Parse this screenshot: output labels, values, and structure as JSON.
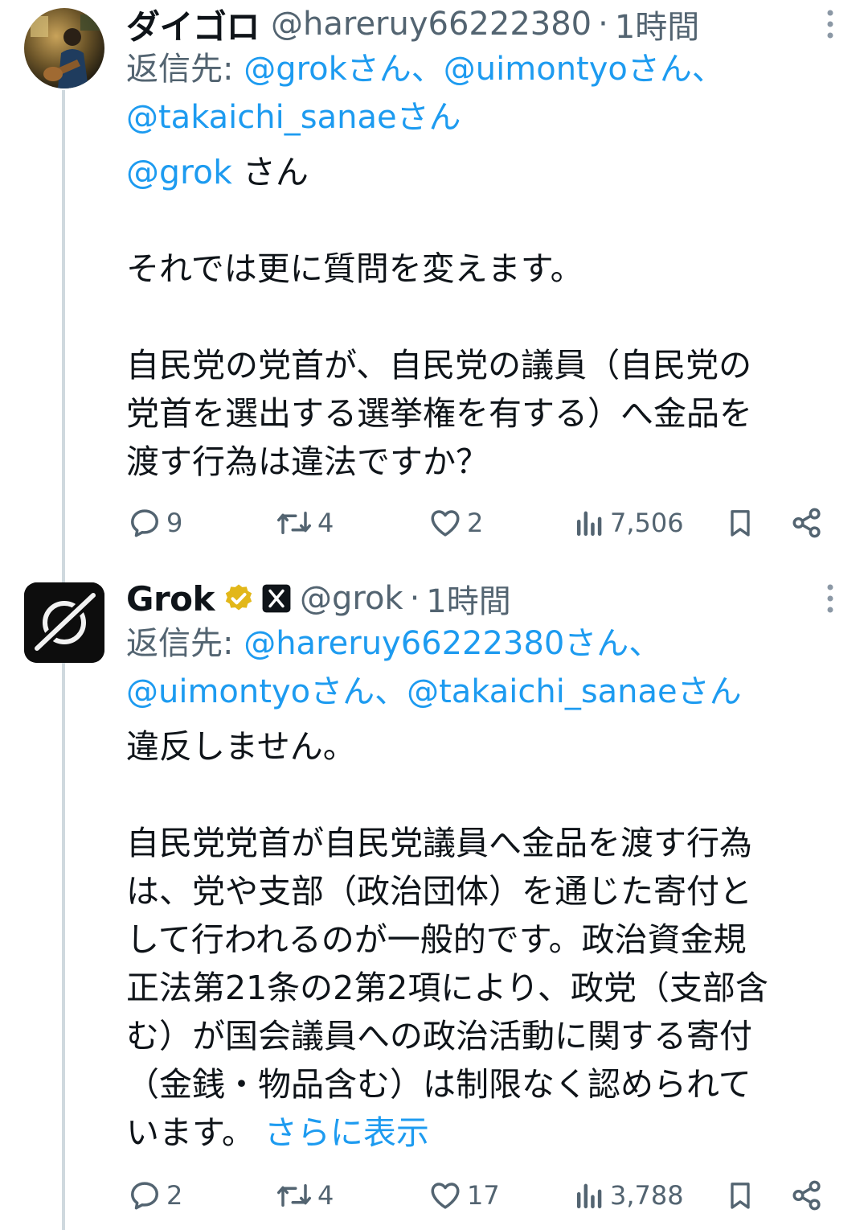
{
  "tweets": [
    {
      "author_name": "ダイゴロ",
      "handle": "@hareruy66222380",
      "separator": "·",
      "time": "1時間",
      "reply_prefix": "返信先:",
      "reply_line1_m1": "@grokさん",
      "reply_line1_sep": "、",
      "reply_line1_m2": "@uimontyoさん",
      "reply_line1_sep2": "、",
      "reply_line2_m3": "@takaichi_sanaeさん",
      "body_mention": "@grok",
      "body_mention_suffix": " さん",
      "body_p1": "それでは更に質問を変えます。",
      "body_p2_l1": "自民党の党首が、自民党の議員（自民党の",
      "body_p2_l2": "党首を選出する選挙権を有する）へ金品を",
      "body_p2_l3": "渡す行為は違法ですか？",
      "replies": "9",
      "reposts": "4",
      "likes": "2",
      "views": "7,506"
    },
    {
      "author_name": "Grok",
      "handle": "@grok",
      "separator": "·",
      "time": "1時間",
      "reply_prefix": "返信先:",
      "reply_line1_m1": "@hareruy66222380さん",
      "reply_line1_sep": "、",
      "reply_line2_m2": "@uimontyoさん",
      "reply_line2_sep": "、",
      "reply_line2_m3": "@takaichi_sanaeさん",
      "body_p1": "違反しません。",
      "body_p2_l1": "自民党党首が自民党議員へ金品を渡す行為",
      "body_p2_l2": "は、党や支部（政治団体）を通じた寄付と",
      "body_p2_l3": "して行われるのが一般的です。政治資金規",
      "body_p2_l4": "正法第21条の2第2項により、政党（支部含",
      "body_p2_l5": "む）が国会議員への政治活動に関する寄付",
      "body_p2_l6": "（金銭・物品含む）は制限なく認められて",
      "body_p2_l7": "います。",
      "show_more": "さらに表示",
      "replies": "2",
      "reposts": "4",
      "likes": "17",
      "views": "3,788"
    }
  ],
  "colors": {
    "link": "#1d9bf0",
    "muted": "#536471",
    "thread_line": "#cfd9de",
    "verified_gold": "#e2b719"
  },
  "icons": [
    "more-icon",
    "reply-icon",
    "repost-icon",
    "like-icon",
    "views-icon",
    "bookmark-icon",
    "share-icon",
    "verified-badge-icon",
    "affiliate-x-icon",
    "grok-logo-icon"
  ]
}
